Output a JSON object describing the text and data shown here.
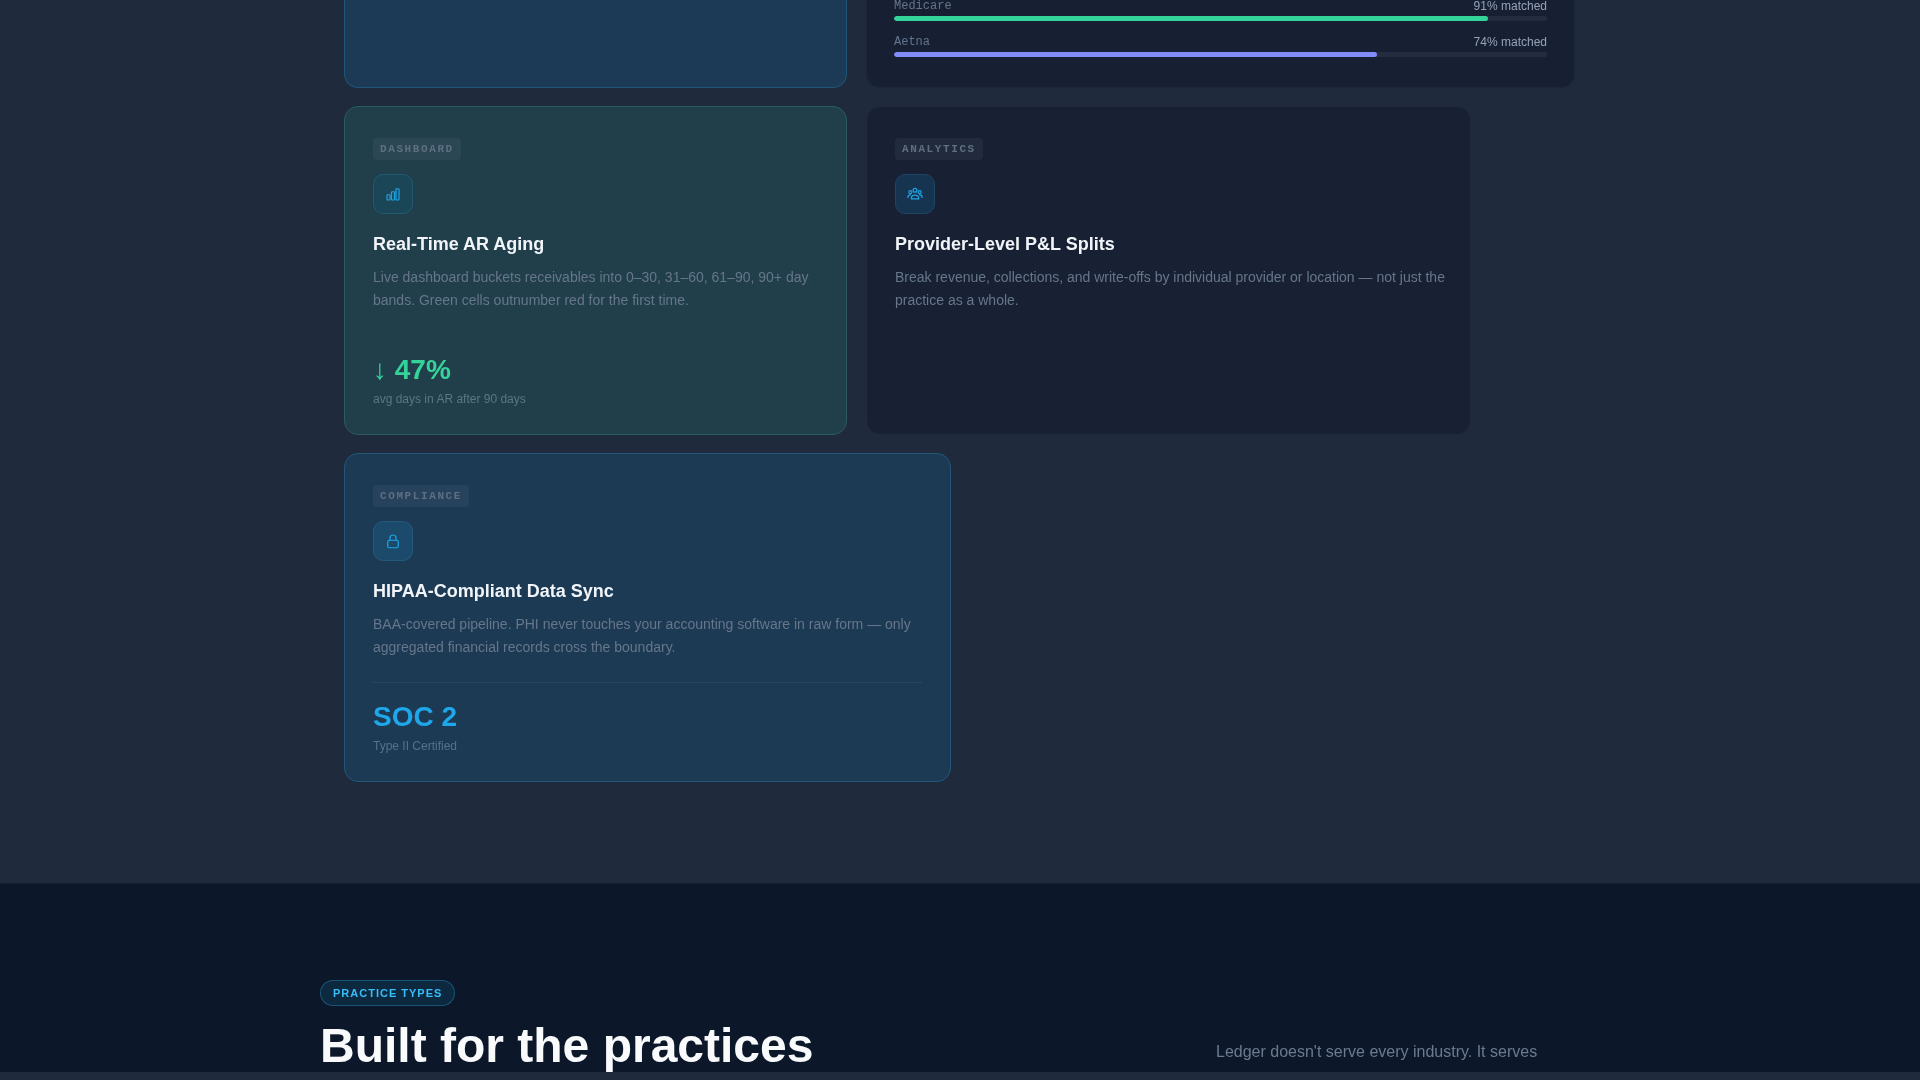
{
  "match_card": {
    "rows": [
      {
        "label": "Medicare",
        "reading": "91% matched",
        "level": 0.91,
        "color": "#34d399"
      },
      {
        "label": "Aetna",
        "reading": "74% matched",
        "level": 0.74,
        "color": "#818cf8"
      }
    ]
  },
  "feature_cards": [
    {
      "kind": "metric",
      "tag": "DASHBOARD",
      "title": "Real-Time AR Aging",
      "description": "Live dashboard buckets receivables into 0–30, 31–60, 61–90, 90+ day bands. Green cells outnumber red for the first time.",
      "stat": {
        "value": "↓ 47%",
        "caption": "avg days in AR after 90 days"
      }
    },
    {
      "kind": "plain",
      "tag": "ANALYTICS",
      "title": "Provider-Level P&L Splits",
      "description": "Break revenue, collections, and write-offs by individual provider or location — not just the practice as a whole."
    },
    {
      "kind": "certified",
      "tag": "COMPLIANCE",
      "title": "HIPAA-Compliant Data Sync",
      "description": "BAA-covered pipeline. PHI never touches your accounting software in raw form — only aggregated financial records cross the boundary.",
      "stat": {
        "value": "SOC 2",
        "caption": "Type II Certified"
      }
    }
  ],
  "practice_section": {
    "eyebrow": "PRACTICE TYPES",
    "heading": "Built for the practices",
    "intro": "Ledger doesn't serve every industry. It serves"
  }
}
